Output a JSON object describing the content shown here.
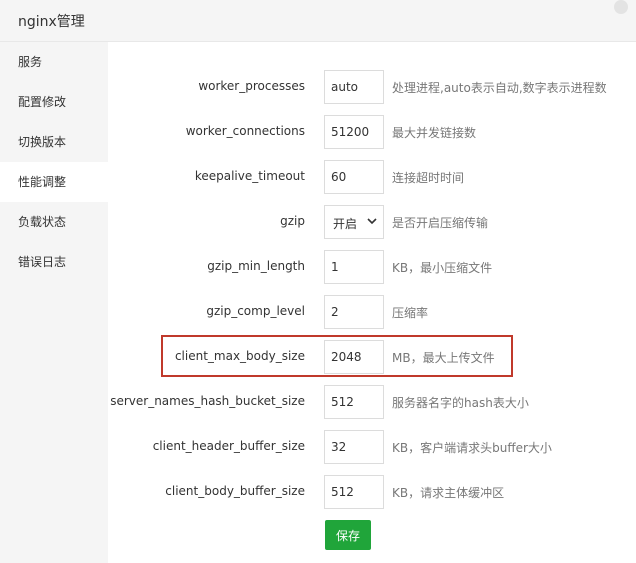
{
  "window": {
    "title": "nginx管理"
  },
  "sidebar": {
    "items": [
      {
        "label": "服务"
      },
      {
        "label": "配置修改"
      },
      {
        "label": "切换版本"
      },
      {
        "label": "性能调整"
      },
      {
        "label": "负载状态"
      },
      {
        "label": "错误日志"
      }
    ],
    "active_item": "性能调整"
  },
  "form": {
    "rows": [
      {
        "label": "worker_processes",
        "value": "auto",
        "help": "处理进程,auto表示自动,数字表示进程数"
      },
      {
        "label": "worker_connections",
        "value": "51200",
        "help": "最大并发链接数"
      },
      {
        "label": "keepalive_timeout",
        "value": "60",
        "help": "连接超时时间"
      },
      {
        "label": "gzip",
        "value": "开启",
        "help": "是否开启压缩传输"
      },
      {
        "label": "gzip_min_length",
        "value": "1",
        "help": "KB，最小压缩文件"
      },
      {
        "label": "gzip_comp_level",
        "value": "2",
        "help": "压缩率"
      },
      {
        "label": "client_max_body_size",
        "value": "2048",
        "help": "MB，最大上传文件"
      },
      {
        "label": "server_names_hash_bucket_size",
        "value": "512",
        "help": "服务器名字的hash表大小"
      },
      {
        "label": "client_header_buffer_size",
        "value": "32",
        "help": "KB，客户端请求头buffer大小"
      },
      {
        "label": "client_body_buffer_size",
        "value": "512",
        "help": "KB，请求主体缓冲区"
      }
    ],
    "save_label": "保存"
  },
  "colors": {
    "accent_green": "#20a53a",
    "highlight_red": "#c0392b"
  }
}
